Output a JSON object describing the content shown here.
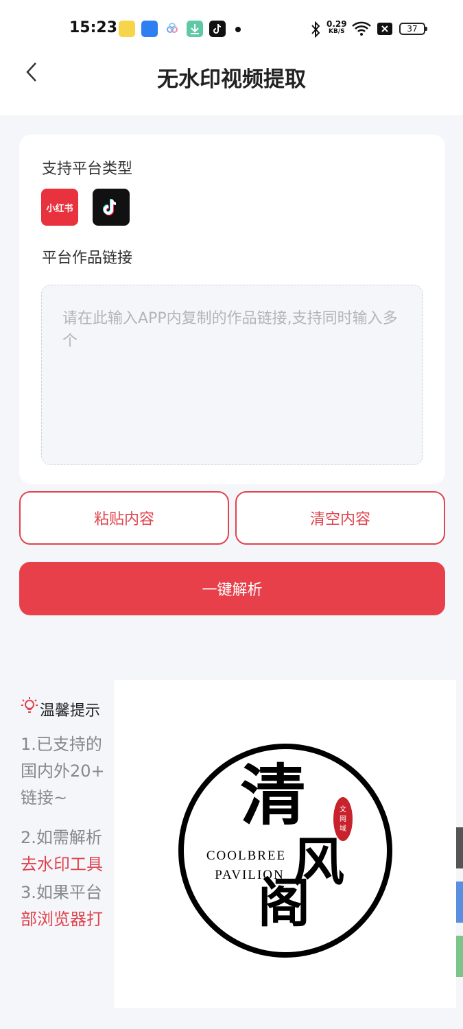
{
  "status_bar": {
    "time": "15:23",
    "net_speed_value": "0.29",
    "net_speed_unit": "KB/S",
    "battery": "37",
    "icons": [
      "app-icon-1",
      "app-icon-2",
      "app-icon-3",
      "download-icon",
      "tiktok-icon",
      "bluetooth-icon",
      "wifi-icon",
      "sim-icon",
      "battery-icon"
    ]
  },
  "header": {
    "title": "无水印视频提取",
    "back_icon": "chevron-left-icon"
  },
  "card": {
    "platforms_label": "支持平台类型",
    "platforms": [
      {
        "name": "小红书",
        "color": "#e8333e"
      },
      {
        "name": "tiktok-logo",
        "color": "#111111"
      }
    ],
    "link_label": "平台作品链接",
    "link_placeholder": "请在此输入APP内复制的作品链接,支持同时输入多个"
  },
  "buttons": {
    "paste": "粘贴内容",
    "clear": "清空内容",
    "parse": "一键解析"
  },
  "tips": {
    "title": "温馨提示",
    "lines": [
      "1.已支持的",
      "国内外20+",
      "链接~",
      "2.如需解析",
      "去水印工具",
      "3.如果平台",
      "部浏览器打"
    ]
  },
  "overlay_logo": {
    "main_chars": [
      "清",
      "风",
      "阁"
    ],
    "text_line1": "COOLBREE",
    "text_line2": "PAVILION",
    "seal": "文网域"
  },
  "colors": {
    "accent": "#e8404a",
    "background": "#f4f6fa",
    "card": "#ffffff"
  }
}
